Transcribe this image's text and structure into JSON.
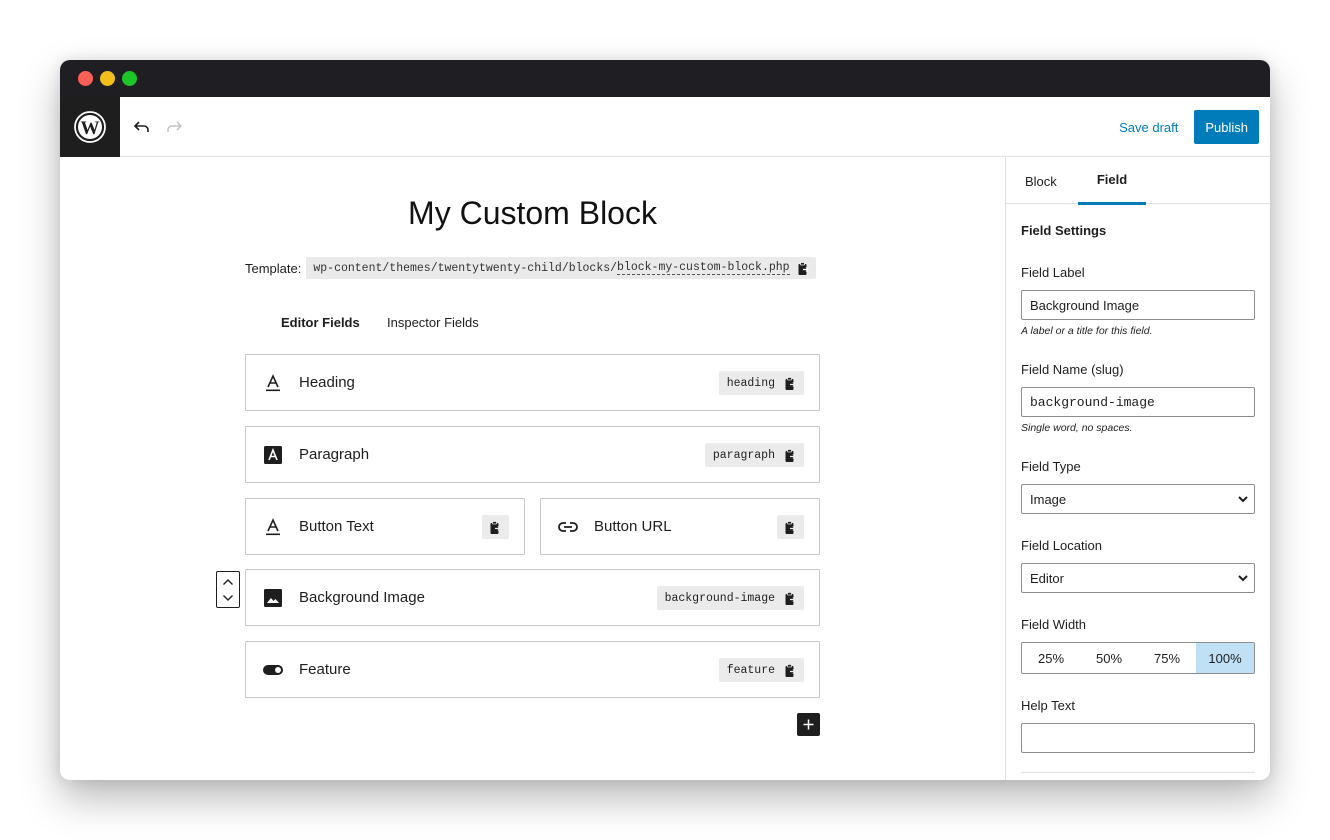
{
  "window": {
    "controls": [
      "close",
      "minimize",
      "maximize"
    ]
  },
  "toolbar": {
    "logo_icon": "wordpress-logo-icon",
    "undo_icon": "undo-icon",
    "redo_icon": "redo-icon",
    "save_draft_label": "Save draft",
    "publish_label": "Publish",
    "accent_color": "#007cba"
  },
  "editor": {
    "title": "My Custom Block",
    "template_label": "Template:",
    "template_path_dir": "wp-content/themes/twentytwenty-child/blocks/",
    "template_path_file": "block-my-custom-block.php",
    "tabs": [
      {
        "label": "Editor Fields",
        "active": true
      },
      {
        "label": "Inspector Fields",
        "active": false
      }
    ],
    "fields": [
      {
        "label": "Heading",
        "slug": "heading",
        "icon": "text-icon",
        "width": "100%"
      },
      {
        "label": "Paragraph",
        "slug": "paragraph",
        "icon": "textarea-icon",
        "width": "100%"
      },
      {
        "label": "Button Text",
        "slug": "",
        "icon": "text-icon",
        "width": "50%"
      },
      {
        "label": "Button URL",
        "slug": "",
        "icon": "link-icon",
        "width": "50%"
      },
      {
        "label": "Background Image",
        "slug": "background-image",
        "icon": "image-icon",
        "width": "100%",
        "selected": true
      },
      {
        "label": "Feature",
        "slug": "feature",
        "icon": "toggle-icon",
        "width": "100%"
      }
    ],
    "add_field_icon": "plus-icon"
  },
  "sidebar": {
    "tabs": [
      {
        "label": "Block",
        "active": false
      },
      {
        "label": "Field",
        "active": true
      }
    ],
    "section_title": "Field Settings",
    "field_label": {
      "label": "Field Label",
      "value": "Background Image",
      "help": "A label or a title for this field."
    },
    "field_name": {
      "label": "Field Name (slug)",
      "value": "background-image",
      "help": "Single word, no spaces."
    },
    "field_type": {
      "label": "Field Type",
      "value": "Image"
    },
    "field_location": {
      "label": "Field Location",
      "value": "Editor"
    },
    "field_width": {
      "label": "Field Width",
      "options": [
        "25%",
        "50%",
        "75%",
        "100%"
      ],
      "selected": "100%",
      "selected_color": "#bfe0f5"
    },
    "help_text": {
      "label": "Help Text",
      "value": ""
    }
  }
}
